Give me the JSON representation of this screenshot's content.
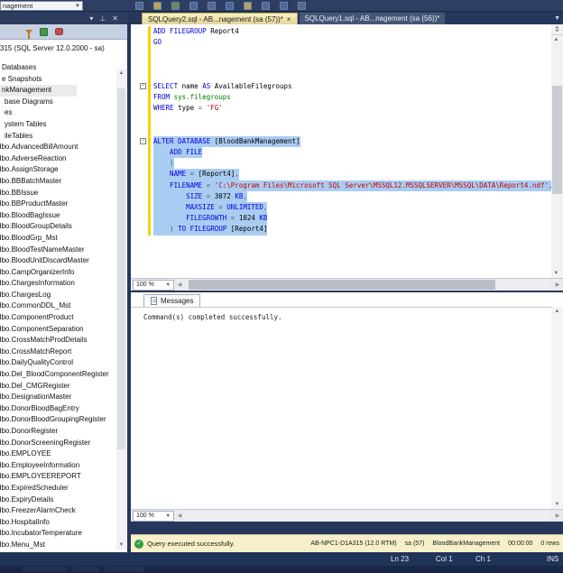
{
  "top_toolbar": {
    "database_combo": "nagement"
  },
  "object_explorer": {
    "header_buttons": {
      "menu": "▾",
      "pin": "⊥",
      "close": "✕"
    },
    "server": "315 (SQL Server 12.0.2000 - sa)",
    "items": [
      {
        "label": "Databases",
        "lvl": 0
      },
      {
        "label": "e Snapshots",
        "lvl": 0
      },
      {
        "label": "nkManagement",
        "lvl": 0,
        "selected": true
      },
      {
        "label": "base Diagrams",
        "lvl": 1
      },
      {
        "label": "es",
        "lvl": 1
      },
      {
        "label": "ystem Tables",
        "lvl": 1
      },
      {
        "label": "ileTables",
        "lvl": 1
      },
      {
        "label": "dbo.AdvancedBillAmount",
        "lvl": 2
      },
      {
        "label": "dbo.AdverseReaction",
        "lvl": 2
      },
      {
        "label": "dbo.AssignStorage",
        "lvl": 2
      },
      {
        "label": "dbo.BBBatchMaster",
        "lvl": 2
      },
      {
        "label": "dbo.BBIssue",
        "lvl": 2
      },
      {
        "label": "dbo.BBProductMaster",
        "lvl": 2
      },
      {
        "label": "dbo.BloodBagIssue",
        "lvl": 2
      },
      {
        "label": "dbo.BloodGroupDetails",
        "lvl": 2
      },
      {
        "label": "dbo.BloodGrp_Mst",
        "lvl": 2
      },
      {
        "label": "dbo.BloodTestNameMaster",
        "lvl": 2
      },
      {
        "label": "dbo.BloodUnitDiscardMaster",
        "lvl": 2
      },
      {
        "label": "dbo.CampOrganizerInfo",
        "lvl": 2
      },
      {
        "label": "dbo.ChargesInformation",
        "lvl": 2
      },
      {
        "label": "dbo.ChargesLog",
        "lvl": 2
      },
      {
        "label": "dbo.CommonDDL_Mst",
        "lvl": 2
      },
      {
        "label": "dbo.ComponentProduct",
        "lvl": 2
      },
      {
        "label": "dbo.ComponentSeparation",
        "lvl": 2
      },
      {
        "label": "dbo.CrossMatchProdDetails",
        "lvl": 2
      },
      {
        "label": "dbo.CrossMatchReport",
        "lvl": 2
      },
      {
        "label": "dbo.DailyQualityControl",
        "lvl": 2
      },
      {
        "label": "dbo.Del_BloodComponentRegister",
        "lvl": 2
      },
      {
        "label": "dbo.Del_CMGRegister",
        "lvl": 2
      },
      {
        "label": "dbo.DesignationMaster",
        "lvl": 2
      },
      {
        "label": "dbo.DonorBloodBagEntry",
        "lvl": 2
      },
      {
        "label": "dbo.DonorBloodGroupingRegister",
        "lvl": 2
      },
      {
        "label": "dbo.DonorRegister",
        "lvl": 2
      },
      {
        "label": "dbo.DonorScreeningRegister",
        "lvl": 2
      },
      {
        "label": "dbo.EMPLOYEE",
        "lvl": 2
      },
      {
        "label": "dbo.EmployeeInformation",
        "lvl": 2
      },
      {
        "label": "dbo.EMPLOYEEREPORT",
        "lvl": 2
      },
      {
        "label": "dbo.ExpiredScheduler",
        "lvl": 2
      },
      {
        "label": "dbo.ExpiryDetails",
        "lvl": 2
      },
      {
        "label": "dbo.FreezerAlarmCheck",
        "lvl": 2
      },
      {
        "label": "dbo.HospitalInfo",
        "lvl": 2
      },
      {
        "label": "dbo.IncubatorTemperature",
        "lvl": 2
      },
      {
        "label": "dbo.Menu_Mst",
        "lvl": 2
      }
    ]
  },
  "editor": {
    "tabs": [
      {
        "label": "SQLQuery2.sql - AB...nagement (sa (57))*",
        "close": "×",
        "active": true
      },
      {
        "label": "SQLQuery1.sql - AB...nagement (sa (56))*",
        "active": false
      }
    ],
    "zoom": "100 %",
    "lines": [
      {
        "tokens": [
          [
            "kw",
            "ADD FILEGROUP"
          ],
          [
            "id",
            " Report4"
          ]
        ]
      },
      {
        "tokens": [
          [
            "kw",
            "GO"
          ]
        ]
      },
      {
        "tokens": []
      },
      {
        "tokens": []
      },
      {
        "tokens": []
      },
      {
        "fold": true,
        "tokens": [
          [
            "kw",
            "SELECT"
          ],
          [
            "id",
            " name "
          ],
          [
            "kw",
            "AS"
          ],
          [
            "id",
            " AvailableFilegroups"
          ]
        ]
      },
      {
        "tokens": [
          [
            "kw",
            "FROM"
          ],
          [
            "sys",
            " sys.filegroups"
          ]
        ]
      },
      {
        "tokens": [
          [
            "kw",
            "WHERE"
          ],
          [
            "id",
            " type "
          ],
          [
            "op",
            "="
          ],
          [
            "str",
            " 'FG'"
          ]
        ]
      },
      {
        "tokens": []
      },
      {
        "tokens": []
      },
      {
        "fold": true,
        "sel": true,
        "tokens": [
          [
            "kw",
            "ALTER DATABASE"
          ],
          [
            "id",
            " [BloodBankManagement]"
          ]
        ]
      },
      {
        "sel": true,
        "tokens": [
          [
            "kw",
            "    ADD FILE"
          ]
        ]
      },
      {
        "sel": true,
        "tokens": [
          [
            "op",
            "    ("
          ]
        ]
      },
      {
        "sel": true,
        "tokens": [
          [
            "kw",
            "    NAME"
          ],
          [
            "op",
            " = "
          ],
          [
            "id",
            "[Report4]"
          ],
          [
            "op",
            ","
          ]
        ]
      },
      {
        "sel": true,
        "tokens": [
          [
            "kw",
            "    FILENAME"
          ],
          [
            "op",
            " = "
          ],
          [
            "str",
            "'C:\\Program Files\\Microsoft SQL Server\\MSSQL12.MSSQLSERVER\\MSSQL\\DATA\\Report4.ndf'"
          ],
          [
            "op",
            ","
          ]
        ]
      },
      {
        "sel": true,
        "tokens": [
          [
            "kw",
            "        SIZE"
          ],
          [
            "op",
            " = "
          ],
          [
            "num",
            "3072 "
          ],
          [
            "kw",
            "KB"
          ],
          [
            "op",
            ","
          ]
        ]
      },
      {
        "sel": true,
        "tokens": [
          [
            "kw",
            "        MAXSIZE"
          ],
          [
            "op",
            " = "
          ],
          [
            "kw",
            "UNLIMITED"
          ],
          [
            "op",
            ","
          ]
        ]
      },
      {
        "sel": true,
        "tokens": [
          [
            "kw",
            "        FILEGROWTH"
          ],
          [
            "op",
            " = "
          ],
          [
            "num",
            "1024 "
          ],
          [
            "kw",
            "KB"
          ]
        ]
      },
      {
        "sel": true,
        "tokens": [
          [
            "op",
            "    ) "
          ],
          [
            "kw",
            "TO FILEGROUP"
          ],
          [
            "id",
            " [Report4]"
          ]
        ]
      }
    ]
  },
  "messages": {
    "tab": "Messages",
    "zoom": "100 %",
    "text": "Command(s) completed successfully."
  },
  "result_bar": {
    "status": "Query executed successfully.",
    "server": "AB-NPC1-D1A315 (12.0 RTM)",
    "user": "sa (57)",
    "database": "BloodBankManagement",
    "time": "00:00:00",
    "rows": "0 rows"
  },
  "status_bar": {
    "ln": "Ln 23",
    "col": "Col 1",
    "ch": "Ch 1",
    "mode": "INS"
  }
}
